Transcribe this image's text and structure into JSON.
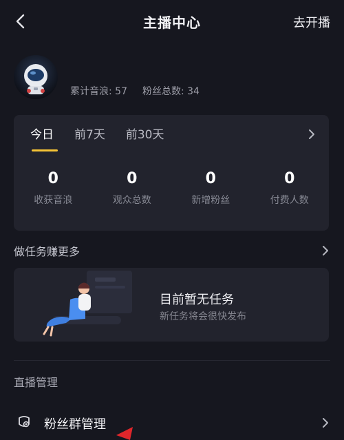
{
  "header": {
    "title": "主播中心",
    "action_label": "去开播"
  },
  "profile": {
    "total_yinlang": "累计音浪: 57",
    "total_fans": "粉丝总数: 34"
  },
  "stats": {
    "tabs": [
      "今日",
      "前7天",
      "前30天"
    ],
    "active_tab": "今日",
    "items": [
      {
        "value": "0",
        "label": "收获音浪"
      },
      {
        "value": "0",
        "label": "观众总数"
      },
      {
        "value": "0",
        "label": "新增粉丝"
      },
      {
        "value": "0",
        "label": "付费人数"
      }
    ]
  },
  "tasks": {
    "section_title": "做任务赚更多",
    "empty_title": "目前暂无任务",
    "empty_subtitle": "新任务将会很快发布"
  },
  "live_management": {
    "section_title": "直播管理",
    "items": [
      {
        "label": "粉丝群管理",
        "icon": "fan-group-icon"
      }
    ]
  },
  "colors": {
    "background": "#16171f",
    "card": "#22232d",
    "accent": "#f6c436",
    "annotation": "#e0262b"
  }
}
